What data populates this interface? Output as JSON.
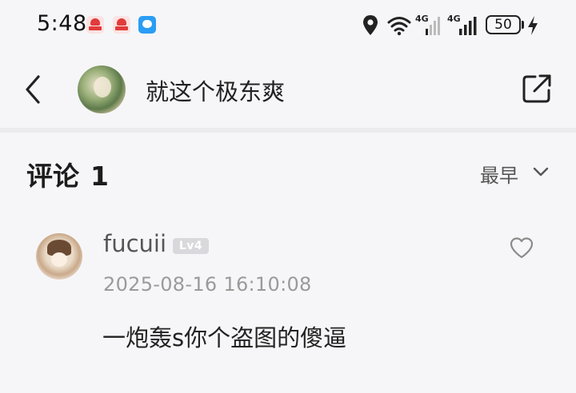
{
  "status_bar": {
    "time": "5:48",
    "network_1": "4G",
    "network_2": "4G",
    "battery": "50",
    "icons": [
      "app-notification-icon",
      "app-notification-icon",
      "message-notification-icon",
      "location-icon",
      "wifi-icon",
      "signal-icon",
      "signal-icon",
      "battery-icon",
      "charging-bolt-icon"
    ]
  },
  "header": {
    "title": "就这个极东爽",
    "back_icon": "back-chevron-icon",
    "share_icon": "share-external-icon"
  },
  "comments": {
    "heading": "评论",
    "count": "1",
    "sort_label": "最早",
    "items": [
      {
        "username": "fucuii",
        "level": "Lv4",
        "timestamp": "2025-08-16 16:10:08",
        "text": "一炮轰s你个盗图的傻逼"
      }
    ]
  },
  "colors": {
    "background": "#f6f6f8",
    "badge": "#d9d9dd",
    "secondary_text": "#9a9a9a"
  }
}
